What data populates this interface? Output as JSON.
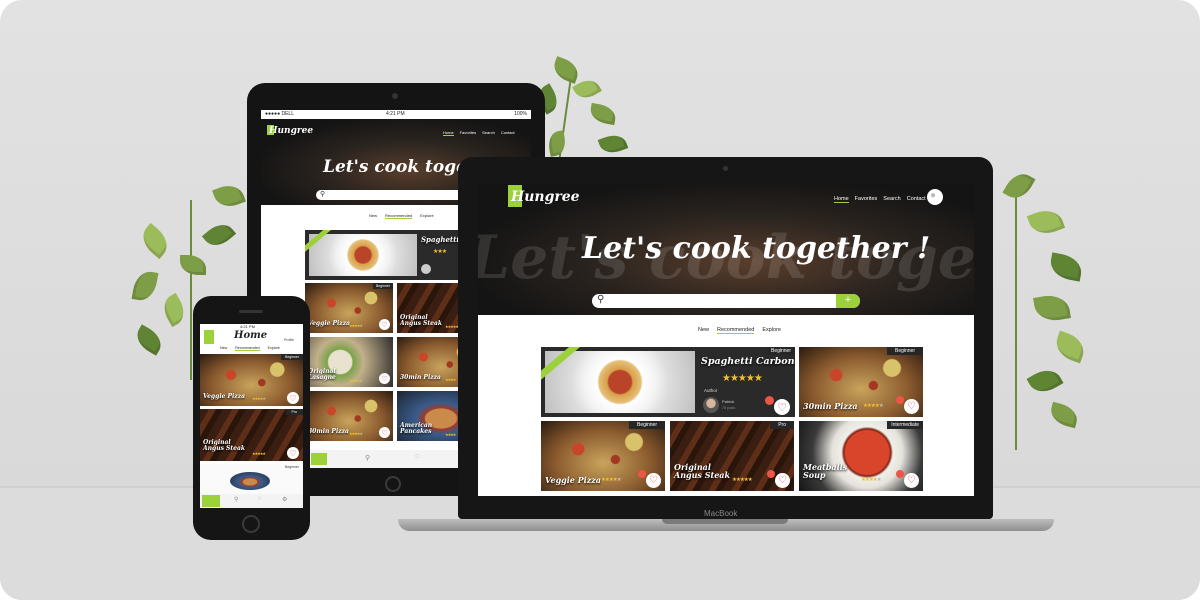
{
  "brand": {
    "logo_text": "Hungree",
    "accent": "#9dd13c"
  },
  "nav": [
    "Home",
    "Favorites",
    "Search",
    "Contact"
  ],
  "hero": {
    "title": "Let's cook together !"
  },
  "tabs": {
    "items": [
      "New",
      "Recommended",
      "Explore"
    ],
    "active": "Recommended"
  },
  "featured": {
    "title": "Spaghetti Carbonara",
    "badge": "Beginner",
    "author_label": "Author",
    "author_name": "Patrick",
    "author_posts": "76 posts",
    "rating": 5
  },
  "cards": [
    {
      "title": "30min Pizza",
      "badge": "Beginner",
      "rating": 4
    },
    {
      "title": "Veggie Pizza",
      "badge": "Beginner",
      "rating": 4
    },
    {
      "title": "Original Angus Steak",
      "badge": "Pro",
      "rating": 5
    },
    {
      "title": "Meatballs Soup",
      "badge": "Intermediate",
      "rating": 4
    }
  ],
  "tablet": {
    "status": {
      "carrier": "●●●●● DELL",
      "time": "4:21 PM",
      "battery": "100%"
    },
    "cards": [
      {
        "title": "Veggie Pizza",
        "badge": "Beginner"
      },
      {
        "title": "Original Angus Steak",
        "badge": "Pro"
      },
      {
        "title": "Original Lasagne",
        "badge": ""
      },
      {
        "title": "30min Pizza",
        "badge": ""
      },
      {
        "title": "30min Pizza",
        "badge": ""
      },
      {
        "title": "American Pancakes",
        "badge": ""
      }
    ]
  },
  "phone": {
    "status_time": "4:21 PM",
    "title": "Home",
    "profile_label": "Profile",
    "tabs": [
      "New",
      "Recommended",
      "Explore"
    ],
    "cards": [
      {
        "title": "Veggie Pizza",
        "badge": "Beginner"
      },
      {
        "title": "Original Angus Steak",
        "badge": "Pro"
      },
      {
        "title": "",
        "badge": "Beginner"
      }
    ]
  },
  "laptop_brand": "MacBook",
  "star_glyph": "★"
}
